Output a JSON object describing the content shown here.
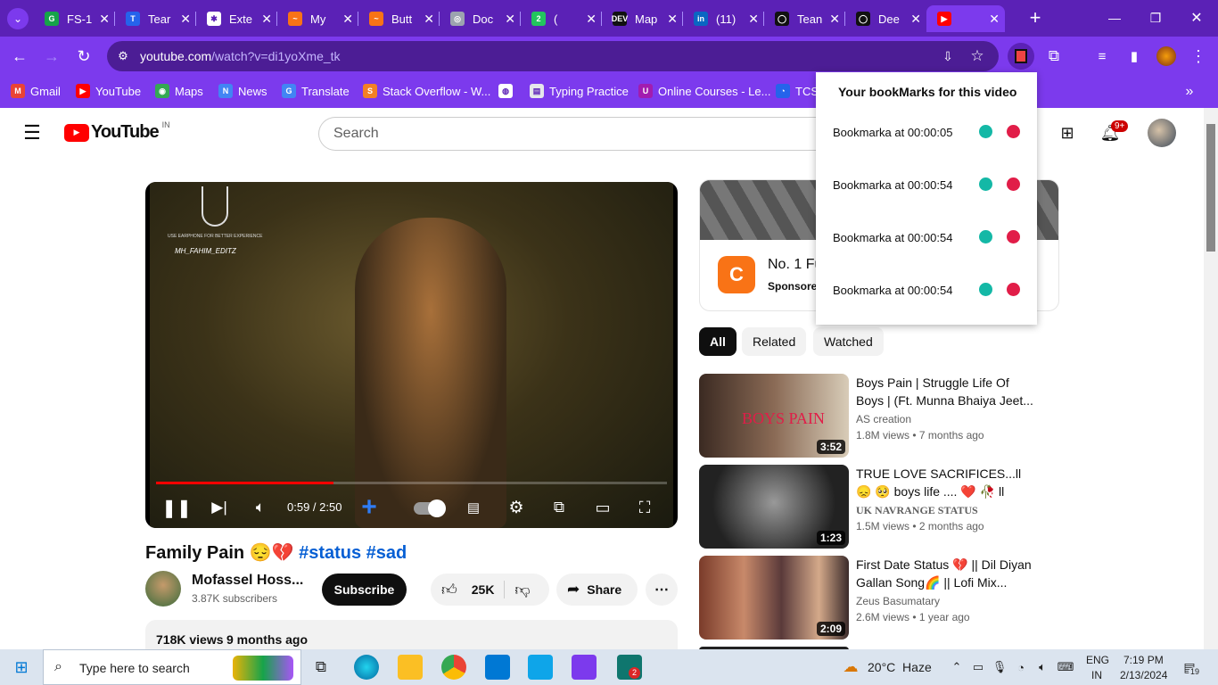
{
  "browser": {
    "tabs": [
      {
        "title": "FS-1",
        "favicon_color": "#16a34a",
        "favicon_text": "G"
      },
      {
        "title": "Tear",
        "favicon_color": "#2563eb",
        "favicon_text": "T"
      },
      {
        "title": "Exte",
        "favicon_color": "#ffffff",
        "favicon_text": "✱"
      },
      {
        "title": "My",
        "favicon_color": "#f97316",
        "favicon_text": "~"
      },
      {
        "title": "Butt",
        "favicon_color": "#f97316",
        "favicon_text": "~"
      },
      {
        "title": "Doc",
        "favicon_color": "#9ca3af",
        "favicon_text": "◎"
      },
      {
        "title": "(",
        "favicon_color": "#22c55e",
        "favicon_text": "2"
      },
      {
        "title": "Map",
        "favicon_color": "#111111",
        "favicon_text": "DEV"
      },
      {
        "title": "(11)",
        "favicon_color": "#0a66c2",
        "favicon_text": "in"
      },
      {
        "title": "Tean",
        "favicon_color": "#111111",
        "favicon_text": "◯"
      },
      {
        "title": "Dee",
        "favicon_color": "#111111",
        "favicon_text": "◯"
      },
      {
        "title": "",
        "favicon_color": "#ff0000",
        "favicon_text": "▶"
      }
    ],
    "url_host": "youtube.com",
    "url_path": "/watch?v=di1yoXme_tk",
    "bookmarks": [
      {
        "label": "Gmail",
        "color": "#ea4335",
        "icon": "M"
      },
      {
        "label": "YouTube",
        "color": "#ff0000",
        "icon": "▶"
      },
      {
        "label": "Maps",
        "color": "#34a853",
        "icon": "◉"
      },
      {
        "label": "News",
        "color": "#4285f4",
        "icon": "N"
      },
      {
        "label": "Translate",
        "color": "#4285f4",
        "icon": "G"
      },
      {
        "label": "Stack Overflow - W...",
        "color": "#f48024",
        "icon": "S"
      },
      {
        "label": "",
        "color": "#ffffff",
        "icon": "◍"
      },
      {
        "label": "Typing Practice",
        "color": "#e5e7eb",
        "icon": "▤"
      },
      {
        "label": "Online Courses - Le...",
        "color": "#a21caf",
        "icon": "U"
      },
      {
        "label": "TCS",
        "color": "#2563eb",
        "icon": "◔"
      }
    ]
  },
  "youtube": {
    "logo": "YouTube",
    "region": "IN",
    "search_placeholder": "Search",
    "notif_count": "9+",
    "video_time": "0:59 / 2:50",
    "video_progress": 0.347,
    "video_watermark": "MH_FAHIM_EDITZ",
    "video_caption": "USE EARPHONE FOR BETTER EXPERIENCE",
    "title": "Family Pain 😔💔 ",
    "hashtags": [
      "#status",
      "#sad"
    ],
    "channel": "Mofassel Hoss...",
    "subscribers": "3.87K subscribers",
    "subscribe_label": "Subscribe",
    "likes": "25K",
    "share_label": "Share",
    "views": "718K views",
    "uploaded": "9 months ago",
    "ad": {
      "title": "No. 1 Fu",
      "sponsor": "Sponsore"
    },
    "chips": [
      "All",
      "Related",
      "Watched"
    ],
    "recommendations": [
      {
        "title": "Boys Pain | Struggle Life Of Boys | (Ft. Munna Bhaiya Jeet...",
        "channel": "AS creation",
        "meta": "1.8M views  • 7 months ago",
        "duration": "3:52"
      },
      {
        "title": "TRUE LOVE SACRIFICES...ll 😞 🥺 boys life .... ❤️ 🥀 ll love...",
        "channel": "UK NAVRANGE STATUS",
        "meta": "1.5M views  • 2 months ago",
        "duration": "1:23"
      },
      {
        "title": "First Date Status 💔 || Dil Diyan Gallan Song🌈 || Lofi Mix...",
        "channel": "Zeus Basumatary",
        "meta": "2.6M views  • 1 year ago",
        "duration": "2:09"
      }
    ]
  },
  "popup": {
    "heading": "Your bookMarks for this video",
    "bookmarks": [
      "Bookmarka at 00:00:05",
      "Bookmarka at 00:00:54",
      "Bookmarka at 00:00:54",
      "Bookmarka at 00:00:54"
    ]
  },
  "taskbar": {
    "search_placeholder": "Type here to search",
    "weather": "20°C  Haze",
    "lang_top": "ENG",
    "lang_bottom": "IN",
    "time": "7:19 PM",
    "date": "2/13/2024",
    "notif": "19",
    "vlc_badge": "2"
  }
}
